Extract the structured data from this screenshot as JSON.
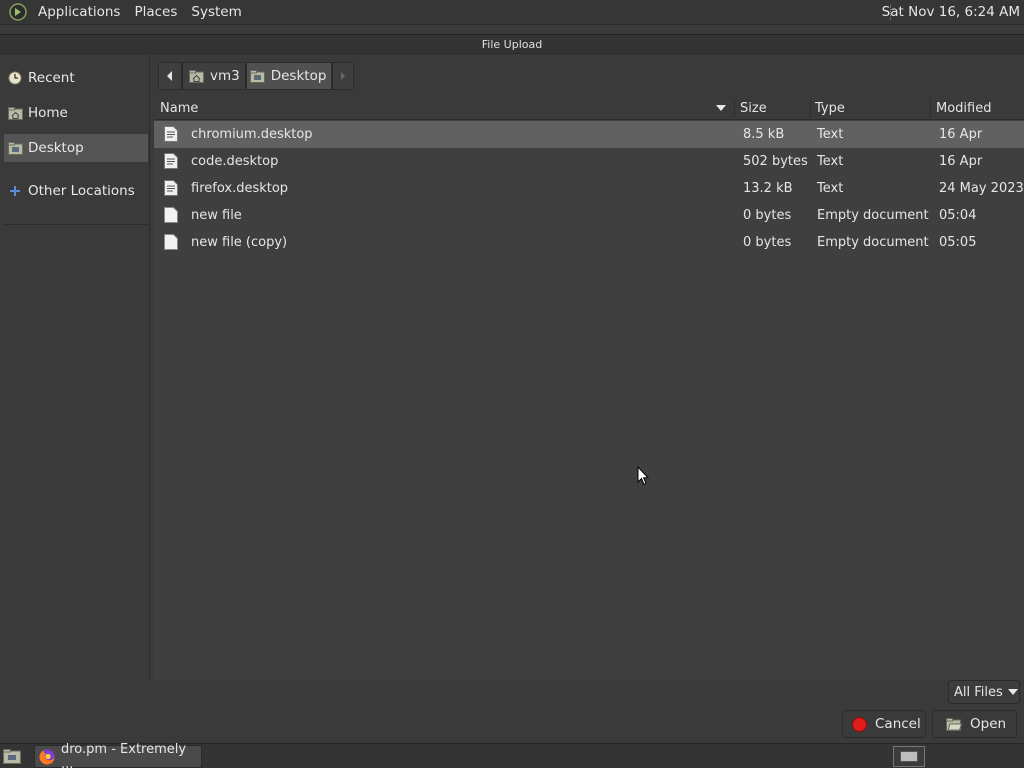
{
  "top_panel": {
    "menus": [
      "Applications",
      "Places",
      "System"
    ],
    "clock": "Sat Nov 16,  6:24 AM"
  },
  "dialog": {
    "title": "File Upload"
  },
  "sidebar": {
    "items": [
      {
        "label": "Recent",
        "icon": "clock-icon"
      },
      {
        "label": "Home",
        "icon": "home-folder-icon"
      },
      {
        "label": "Desktop",
        "icon": "desktop-folder-icon",
        "selected": true
      },
      {
        "label": "Other Locations",
        "icon": "plus-icon"
      }
    ]
  },
  "pathbar": {
    "segments": [
      "vm3",
      "Desktop"
    ],
    "current": "Desktop"
  },
  "file_list": {
    "columns": [
      "Name",
      "Size",
      "Type",
      "Modified"
    ],
    "sort_column": "Name",
    "rows": [
      {
        "name": "chromium.desktop",
        "size": "8.5 kB",
        "type": "Text",
        "modified": "16 Apr",
        "icon": "text-file-icon",
        "selected": true
      },
      {
        "name": "code.desktop",
        "size": "502 bytes",
        "type": "Text",
        "modified": "16 Apr",
        "icon": "text-file-icon"
      },
      {
        "name": "firefox.desktop",
        "size": "13.2 kB",
        "type": "Text",
        "modified": "24 May 2023",
        "icon": "text-file-icon"
      },
      {
        "name": "new file",
        "size": "0 bytes",
        "type": "Empty document",
        "modified": "05:04",
        "icon": "blank-file-icon"
      },
      {
        "name": "new file (copy)",
        "size": "0 bytes",
        "type": "Empty document",
        "modified": "05:05",
        "icon": "blank-file-icon"
      }
    ]
  },
  "filter": {
    "value": "All Files"
  },
  "buttons": {
    "cancel": "Cancel",
    "open": "Open"
  },
  "taskbar": {
    "task_label": "dro.pm - Extremely ..."
  },
  "colors": {
    "panel": "#363636",
    "background": "#3f3f3f",
    "selected_row": "#616161",
    "cancel_red": "#e01b1b"
  }
}
